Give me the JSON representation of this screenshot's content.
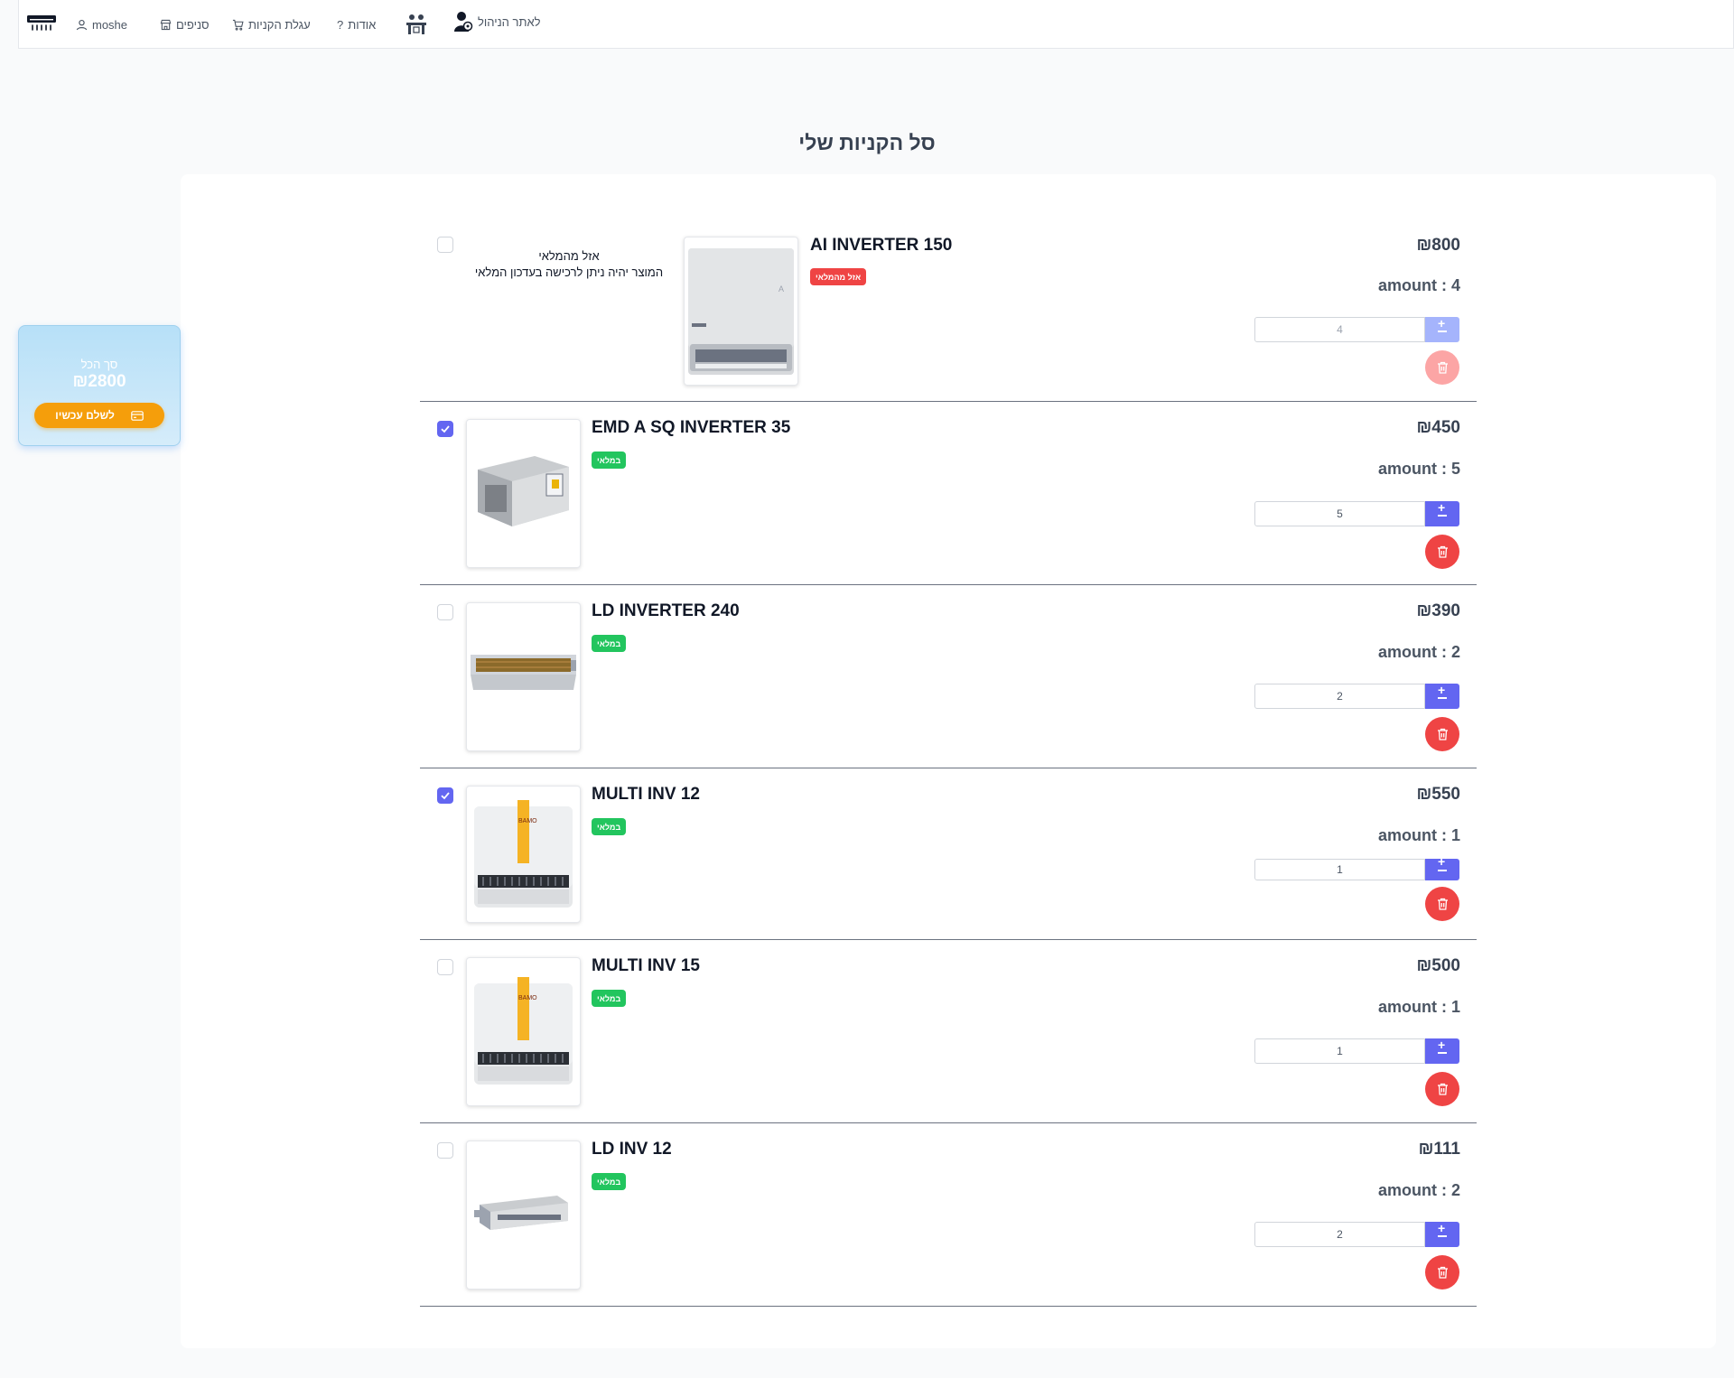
{
  "nav": {
    "user": "moshe",
    "branches": "סניפים",
    "cart": "עגלת הקניות",
    "about": "אודות",
    "admin": "לאתר הניהול"
  },
  "page": {
    "title": "סל הקניות שלי"
  },
  "summary": {
    "label": "סך הכל",
    "total": "₪2800",
    "pay_button": "לשלם עכשיו"
  },
  "items": [
    {
      "name": "AI INVERTER 150",
      "badge": "אזל מהמלאי",
      "in_stock": false,
      "checked": false,
      "note_line1": "אזל מהמלאי",
      "note_line2": "המוצר יהיה ניתן לרכישה בעדכון המלאי",
      "price": "₪800",
      "amount_label": "amount : 4",
      "quantity": "4"
    },
    {
      "name": "EMD A SQ INVERTER 35",
      "badge": "במלאי",
      "in_stock": true,
      "checked": true,
      "price": "₪450",
      "amount_label": "amount : 5",
      "quantity": "5"
    },
    {
      "name": "LD INVERTER 240",
      "badge": "במלאי",
      "in_stock": true,
      "checked": false,
      "price": "₪390",
      "amount_label": "amount : 2",
      "quantity": "2"
    },
    {
      "name": "MULTI INV 12",
      "badge": "במלאי",
      "in_stock": true,
      "checked": true,
      "price": "₪550",
      "amount_label": "amount : 1",
      "quantity": "1"
    },
    {
      "name": "MULTI INV 15",
      "badge": "במלאי",
      "in_stock": true,
      "checked": false,
      "price": "₪500",
      "amount_label": "amount : 1",
      "quantity": "1"
    },
    {
      "name": "LD INV 12",
      "badge": "במלאי",
      "in_stock": true,
      "checked": false,
      "price": "₪111",
      "amount_label": "amount : 2",
      "quantity": "2"
    }
  ],
  "colors": {
    "accent": "#6366f1",
    "danger": "#ef4444",
    "success": "#22c55e",
    "pay": "#f59e0b"
  },
  "icons": {
    "logo": "air-conditioner-icon",
    "user": "user-icon",
    "branches": "store-icon",
    "cart": "cart-icon",
    "about": "question-icon",
    "admin": "admin-user-icon",
    "pay": "credit-card-icon",
    "delete": "trash-icon"
  }
}
